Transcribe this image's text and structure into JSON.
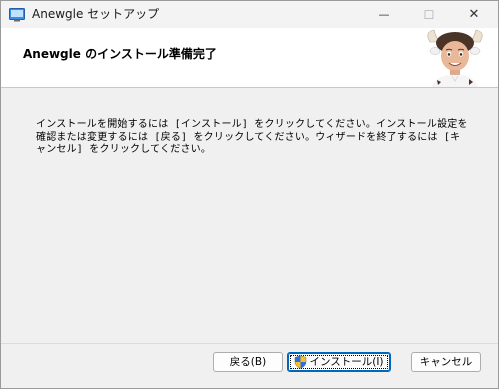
{
  "window": {
    "title": "Anewgle セットアップ",
    "icon": "installer-app-icon",
    "controls": {
      "minimize": "—",
      "maximize": "☐",
      "close": "✕"
    }
  },
  "banner": {
    "title": "Anewgle のインストール準備完了",
    "image": "mascot-character-image"
  },
  "body": {
    "instructions": "インストールを開始するには [インストール] をクリックしてください。インストール設定を確認または変更するには [戻る] をクリックしてください。ウィザードを終了するには [キャンセル] をクリックしてください。"
  },
  "buttons": {
    "back": "戻る(B)",
    "install": "インストール(I)",
    "install_icon": "uac-shield-icon",
    "cancel": "キャンセル"
  },
  "colors": {
    "accent": "#0067c0",
    "window_bg": "#f0f0f0",
    "banner_bg": "#ffffff"
  }
}
